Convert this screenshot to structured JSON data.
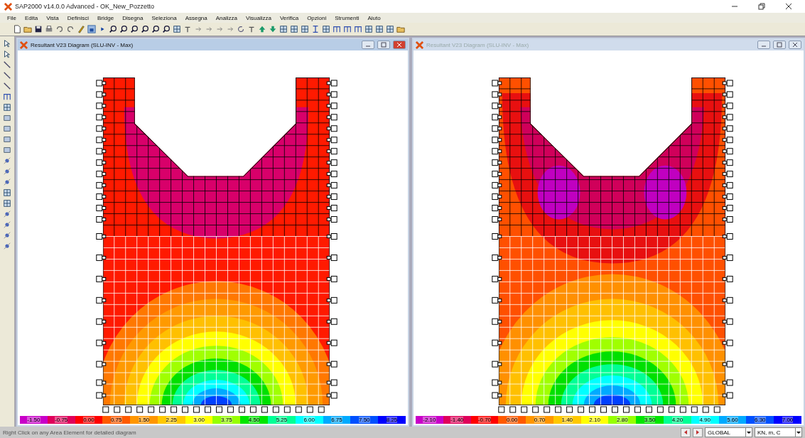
{
  "app": {
    "title": "SAP2000 v14.0.0 Advanced  - OK_New_Pozzetto"
  },
  "menu": [
    {
      "label": "File"
    },
    {
      "label": "Edita"
    },
    {
      "label": "Vista"
    },
    {
      "label": "Definisci"
    },
    {
      "label": "Bridge"
    },
    {
      "label": "Disegna"
    },
    {
      "label": "Seleziona"
    },
    {
      "label": "Assegna"
    },
    {
      "label": "Analizza"
    },
    {
      "label": "Visualizza"
    },
    {
      "label": "Verifica"
    },
    {
      "label": "Opzioni"
    },
    {
      "label": "Strumenti"
    },
    {
      "label": "Aiuto"
    }
  ],
  "windows": [
    {
      "title": "Resultant V23 Diagram  (SLU-INV - Max)",
      "active": true,
      "legend": [
        {
          "label": "-1.50",
          "color": "#c800c8"
        },
        {
          "label": "-0.75",
          "color": "#e0005a"
        },
        {
          "label": "0.00",
          "color": "#ff0000"
        },
        {
          "label": "0.75",
          "color": "#ff5a00"
        },
        {
          "label": "1.50",
          "color": "#ff9600"
        },
        {
          "label": "2.25",
          "color": "#ffc800"
        },
        {
          "label": "3.00",
          "color": "#ffff00"
        },
        {
          "label": "3.75",
          "color": "#96ff00"
        },
        {
          "label": "4.50",
          "color": "#00e600"
        },
        {
          "label": "5.25",
          "color": "#00ff96"
        },
        {
          "label": "6.00",
          "color": "#00ffff"
        },
        {
          "label": "6.75",
          "color": "#00aaff"
        },
        {
          "label": "7.50",
          "color": "#0050ff"
        },
        {
          "label": "8.25",
          "color": "#0000ff"
        }
      ]
    },
    {
      "title": "Resultant V23 Diagram  (SLU-INV - Max)",
      "active": false,
      "legend": [
        {
          "label": "-2.10",
          "color": "#c800c8"
        },
        {
          "label": "-1.40",
          "color": "#e0005a"
        },
        {
          "label": "-0.70",
          "color": "#ff0000"
        },
        {
          "label": "0.00",
          "color": "#ff5a00"
        },
        {
          "label": "0.70",
          "color": "#ff9600"
        },
        {
          "label": "1.40",
          "color": "#ffc800"
        },
        {
          "label": "2.10",
          "color": "#ffff00"
        },
        {
          "label": "2.80",
          "color": "#96ff00"
        },
        {
          "label": "3.50",
          "color": "#00e600"
        },
        {
          "label": "4.20",
          "color": "#00ff96"
        },
        {
          "label": "4.90",
          "color": "#00ffff"
        },
        {
          "label": "5.60",
          "color": "#00aaff"
        },
        {
          "label": "6.30",
          "color": "#0050ff"
        },
        {
          "label": "7.00",
          "color": "#0000ff"
        }
      ]
    }
  ],
  "status_bar": {
    "message": "Right Click on any Area Element for detailed diagram",
    "coordinate_system": "GLOBAL",
    "units": "KN, m, C"
  }
}
